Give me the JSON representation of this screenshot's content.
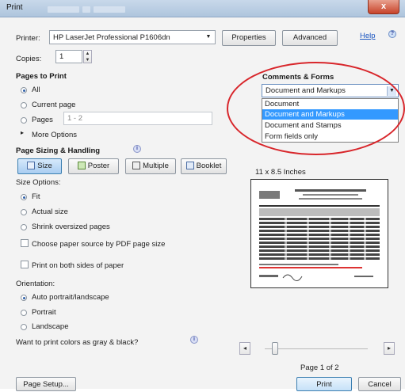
{
  "window": {
    "title": "Print",
    "close_glyph": "x"
  },
  "printer": {
    "label": "Printer:",
    "value": "HP LaserJet Professional P1606dn",
    "properties_label": "Properties",
    "advanced_label": "Advanced",
    "help_label": "Help"
  },
  "copies": {
    "label": "Copies:",
    "value": "1"
  },
  "pages_to_print": {
    "heading": "Pages to Print",
    "all_label": "All",
    "current_label": "Current page",
    "pages_label": "Pages",
    "pages_value": "1 - 2",
    "more_options_label": "More Options"
  },
  "sizing": {
    "heading": "Page Sizing & Handling",
    "size_label": "Size",
    "poster_label": "Poster",
    "multiple_label": "Multiple",
    "booklet_label": "Booklet",
    "size_options_label": "Size Options:",
    "fit_label": "Fit",
    "actual_label": "Actual size",
    "shrink_label": "Shrink oversized pages",
    "choose_source_label": "Choose paper source by PDF page size",
    "both_sides_label": "Print on both sides of paper"
  },
  "orientation": {
    "label": "Orientation:",
    "auto_label": "Auto portrait/landscape",
    "portrait_label": "Portrait",
    "landscape_label": "Landscape"
  },
  "gray_label": "Want to print colors as gray & black?",
  "comments_forms": {
    "heading": "Comments & Forms",
    "selected": "Document and Markups",
    "options": [
      "Document",
      "Document and Markups",
      "Document and Stamps",
      "Form fields only"
    ],
    "highlight_color": "#3399ff",
    "annotation_color": "#d8262b"
  },
  "preview": {
    "size_label": "11 x 8.5 Inches",
    "page_label": "Page 1 of 2"
  },
  "footer": {
    "page_setup_label": "Page Setup...",
    "print_label": "Print",
    "cancel_label": "Cancel"
  }
}
